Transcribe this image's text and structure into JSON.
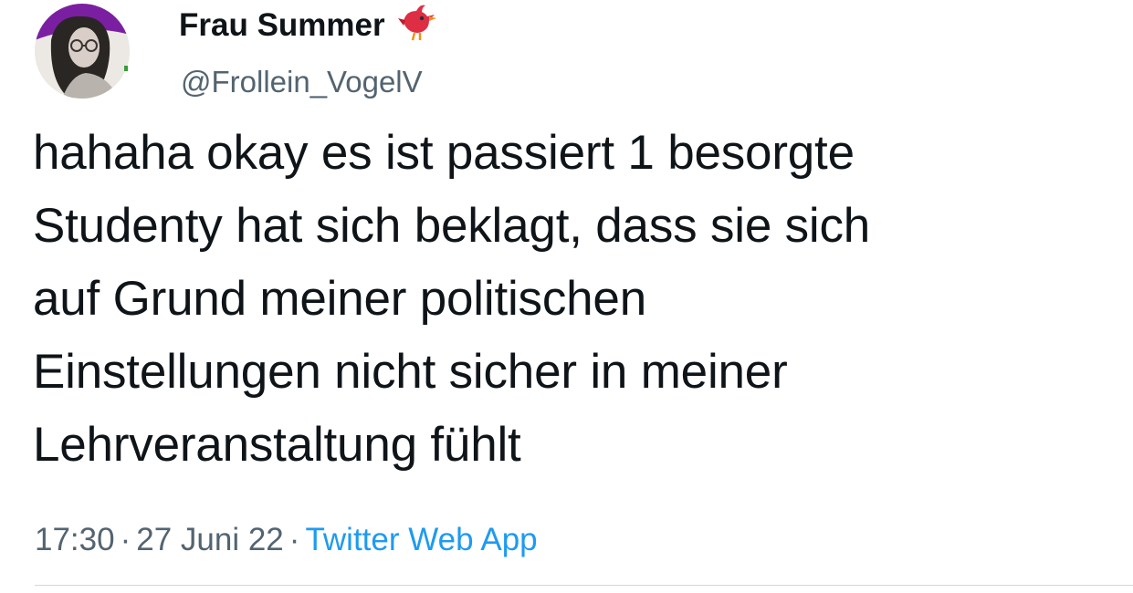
{
  "author": {
    "display_name": "Frau Summer",
    "name_emoji_icon": "red-bird-icon",
    "handle": "@Frollein_VogelV"
  },
  "tweet": {
    "text": "hahaha okay es ist passiert 1 besorgte\nStudenty hat sich beklagt, dass sie sich\nauf Grund meiner politischen\nEinstellungen nicht sicher in meiner\nLehrveranstaltung fühlt"
  },
  "meta": {
    "time": "17:30",
    "date": "27 Juni 22",
    "separator": "·",
    "source": "Twitter Web App"
  },
  "colors": {
    "text": "#0f1419",
    "secondary": "#536471",
    "link": "#1d9bf0",
    "avatar_ring": "#7b1fa2",
    "divider": "#cfd9de"
  }
}
